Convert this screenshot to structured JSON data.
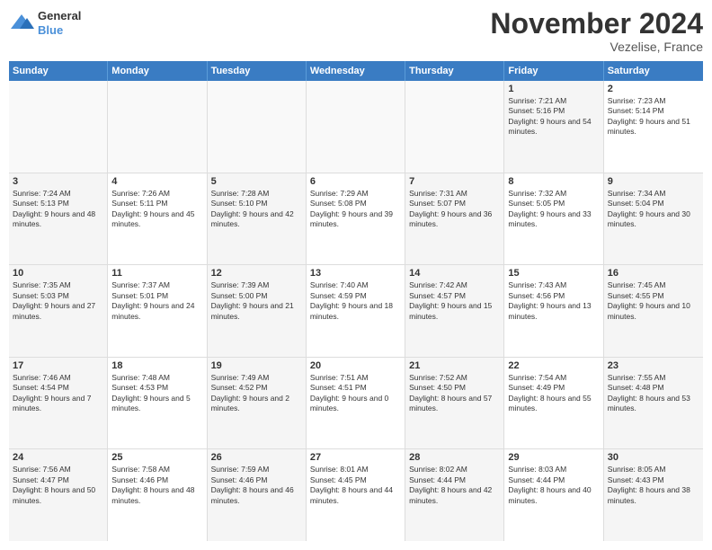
{
  "logo": {
    "line1": "General",
    "line2": "Blue"
  },
  "title": "November 2024",
  "location": "Vezelise, France",
  "days_header": [
    "Sunday",
    "Monday",
    "Tuesday",
    "Wednesday",
    "Thursday",
    "Friday",
    "Saturday"
  ],
  "rows": [
    [
      {
        "day": "",
        "text": "",
        "empty": true
      },
      {
        "day": "",
        "text": "",
        "empty": true
      },
      {
        "day": "",
        "text": "",
        "empty": true
      },
      {
        "day": "",
        "text": "",
        "empty": true
      },
      {
        "day": "",
        "text": "",
        "empty": true
      },
      {
        "day": "1",
        "text": "Sunrise: 7:21 AM\nSunset: 5:16 PM\nDaylight: 9 hours and 54 minutes.",
        "shaded": true
      },
      {
        "day": "2",
        "text": "Sunrise: 7:23 AM\nSunset: 5:14 PM\nDaylight: 9 hours and 51 minutes.",
        "shaded": false
      }
    ],
    [
      {
        "day": "3",
        "text": "Sunrise: 7:24 AM\nSunset: 5:13 PM\nDaylight: 9 hours and 48 minutes.",
        "shaded": true
      },
      {
        "day": "4",
        "text": "Sunrise: 7:26 AM\nSunset: 5:11 PM\nDaylight: 9 hours and 45 minutes.",
        "shaded": false
      },
      {
        "day": "5",
        "text": "Sunrise: 7:28 AM\nSunset: 5:10 PM\nDaylight: 9 hours and 42 minutes.",
        "shaded": true
      },
      {
        "day": "6",
        "text": "Sunrise: 7:29 AM\nSunset: 5:08 PM\nDaylight: 9 hours and 39 minutes.",
        "shaded": false
      },
      {
        "day": "7",
        "text": "Sunrise: 7:31 AM\nSunset: 5:07 PM\nDaylight: 9 hours and 36 minutes.",
        "shaded": true
      },
      {
        "day": "8",
        "text": "Sunrise: 7:32 AM\nSunset: 5:05 PM\nDaylight: 9 hours and 33 minutes.",
        "shaded": false
      },
      {
        "day": "9",
        "text": "Sunrise: 7:34 AM\nSunset: 5:04 PM\nDaylight: 9 hours and 30 minutes.",
        "shaded": true
      }
    ],
    [
      {
        "day": "10",
        "text": "Sunrise: 7:35 AM\nSunset: 5:03 PM\nDaylight: 9 hours and 27 minutes.",
        "shaded": true
      },
      {
        "day": "11",
        "text": "Sunrise: 7:37 AM\nSunset: 5:01 PM\nDaylight: 9 hours and 24 minutes.",
        "shaded": false
      },
      {
        "day": "12",
        "text": "Sunrise: 7:39 AM\nSunset: 5:00 PM\nDaylight: 9 hours and 21 minutes.",
        "shaded": true
      },
      {
        "day": "13",
        "text": "Sunrise: 7:40 AM\nSunset: 4:59 PM\nDaylight: 9 hours and 18 minutes.",
        "shaded": false
      },
      {
        "day": "14",
        "text": "Sunrise: 7:42 AM\nSunset: 4:57 PM\nDaylight: 9 hours and 15 minutes.",
        "shaded": true
      },
      {
        "day": "15",
        "text": "Sunrise: 7:43 AM\nSunset: 4:56 PM\nDaylight: 9 hours and 13 minutes.",
        "shaded": false
      },
      {
        "day": "16",
        "text": "Sunrise: 7:45 AM\nSunset: 4:55 PM\nDaylight: 9 hours and 10 minutes.",
        "shaded": true
      }
    ],
    [
      {
        "day": "17",
        "text": "Sunrise: 7:46 AM\nSunset: 4:54 PM\nDaylight: 9 hours and 7 minutes.",
        "shaded": true
      },
      {
        "day": "18",
        "text": "Sunrise: 7:48 AM\nSunset: 4:53 PM\nDaylight: 9 hours and 5 minutes.",
        "shaded": false
      },
      {
        "day": "19",
        "text": "Sunrise: 7:49 AM\nSunset: 4:52 PM\nDaylight: 9 hours and 2 minutes.",
        "shaded": true
      },
      {
        "day": "20",
        "text": "Sunrise: 7:51 AM\nSunset: 4:51 PM\nDaylight: 9 hours and 0 minutes.",
        "shaded": false
      },
      {
        "day": "21",
        "text": "Sunrise: 7:52 AM\nSunset: 4:50 PM\nDaylight: 8 hours and 57 minutes.",
        "shaded": true
      },
      {
        "day": "22",
        "text": "Sunrise: 7:54 AM\nSunset: 4:49 PM\nDaylight: 8 hours and 55 minutes.",
        "shaded": false
      },
      {
        "day": "23",
        "text": "Sunrise: 7:55 AM\nSunset: 4:48 PM\nDaylight: 8 hours and 53 minutes.",
        "shaded": true
      }
    ],
    [
      {
        "day": "24",
        "text": "Sunrise: 7:56 AM\nSunset: 4:47 PM\nDaylight: 8 hours and 50 minutes.",
        "shaded": true
      },
      {
        "day": "25",
        "text": "Sunrise: 7:58 AM\nSunset: 4:46 PM\nDaylight: 8 hours and 48 minutes.",
        "shaded": false
      },
      {
        "day": "26",
        "text": "Sunrise: 7:59 AM\nSunset: 4:46 PM\nDaylight: 8 hours and 46 minutes.",
        "shaded": true
      },
      {
        "day": "27",
        "text": "Sunrise: 8:01 AM\nSunset: 4:45 PM\nDaylight: 8 hours and 44 minutes.",
        "shaded": false
      },
      {
        "day": "28",
        "text": "Sunrise: 8:02 AM\nSunset: 4:44 PM\nDaylight: 8 hours and 42 minutes.",
        "shaded": true
      },
      {
        "day": "29",
        "text": "Sunrise: 8:03 AM\nSunset: 4:44 PM\nDaylight: 8 hours and 40 minutes.",
        "shaded": false
      },
      {
        "day": "30",
        "text": "Sunrise: 8:05 AM\nSunset: 4:43 PM\nDaylight: 8 hours and 38 minutes.",
        "shaded": true
      }
    ]
  ]
}
